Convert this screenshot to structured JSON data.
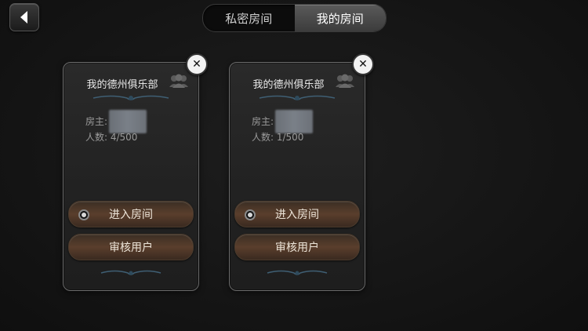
{
  "header": {
    "tabs": [
      {
        "label": "私密房间",
        "active": false
      },
      {
        "label": "我的房间",
        "active": true
      }
    ]
  },
  "rooms": [
    {
      "title": "我的德州俱乐部",
      "owner_label": "房主:",
      "count_label": "人数: 4/500",
      "enter_label": "进入房间",
      "review_label": "审核用户"
    },
    {
      "title": "我的德州俱乐部",
      "owner_label": "房主:",
      "count_label": "人数: 1/500",
      "enter_label": "进入房间",
      "review_label": "审核用户"
    }
  ],
  "icons": {
    "back": "back-arrow-icon",
    "close": "close-icon",
    "members": "members-icon"
  },
  "colors": {
    "background": "#151515",
    "button_accent": "#5a3e2c",
    "active_tab": "#4a4a4a"
  }
}
